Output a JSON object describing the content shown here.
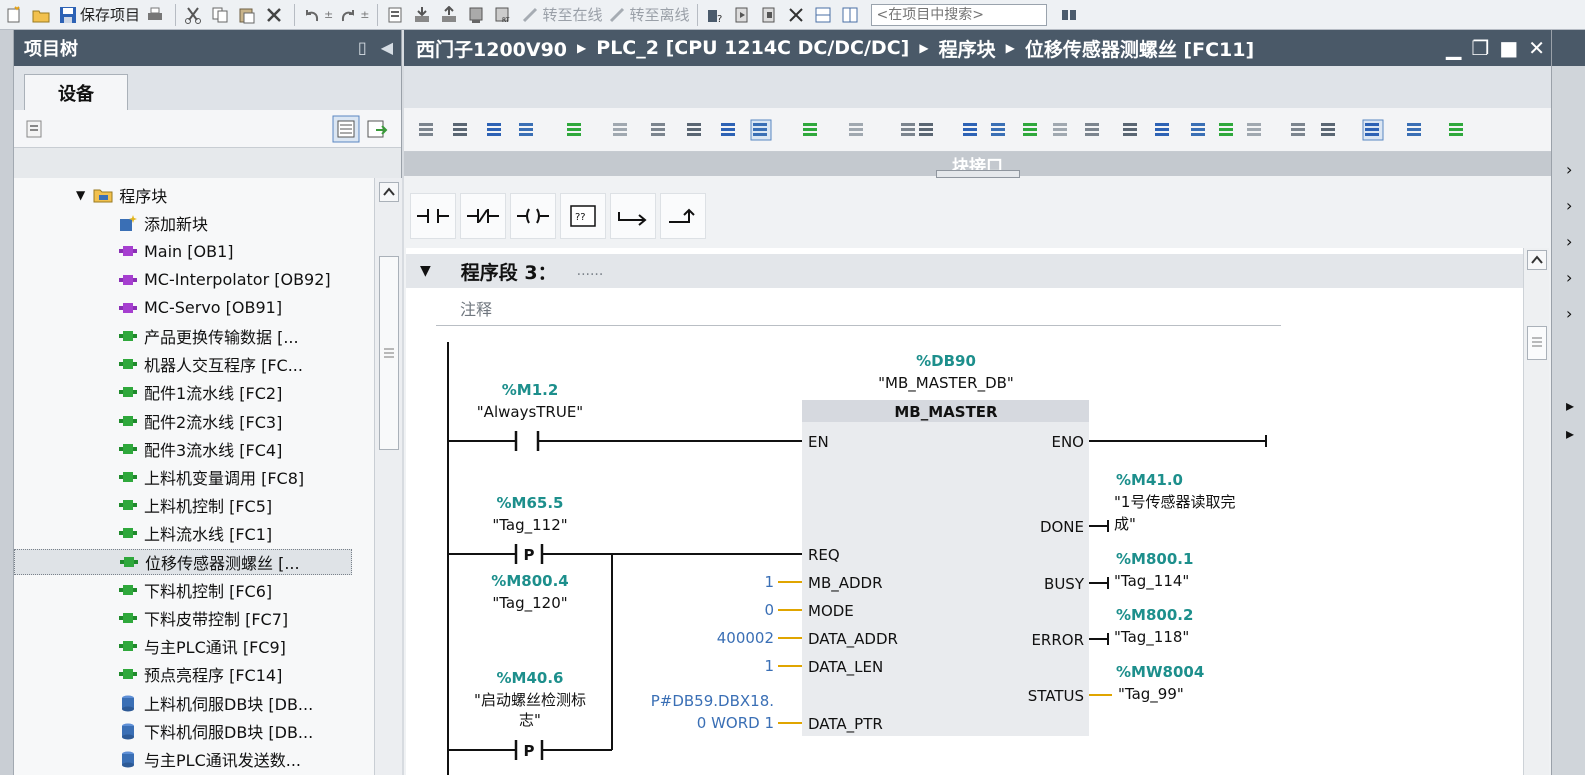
{
  "toolbar": {
    "save_project": "保存项目",
    "go_online": "转至在线",
    "go_offline": "转至离线",
    "search_placeholder": "<在项目中搜索>"
  },
  "project_tree": {
    "title": "项目树",
    "tab_devices": "设备",
    "items": [
      {
        "label": "程序块",
        "icon": "folder-icon",
        "level": 1,
        "expanded": true
      },
      {
        "label": "添加新块",
        "icon": "add-block-icon",
        "level": 2
      },
      {
        "label": "Main [OB1]",
        "icon": "ob-block-icon",
        "level": 2
      },
      {
        "label": "MC-Interpolator [OB92]",
        "icon": "ob-block-icon",
        "level": 2
      },
      {
        "label": "MC-Servo [OB91]",
        "icon": "ob-block-icon",
        "level": 2
      },
      {
        "label": "产品更换传输数据 [...",
        "icon": "fc-block-icon",
        "level": 2
      },
      {
        "label": "机器人交互程序 [FC...",
        "icon": "fc-block-icon",
        "level": 2
      },
      {
        "label": "配件1流水线 [FC2]",
        "icon": "fc-block-icon",
        "level": 2
      },
      {
        "label": "配件2流水线 [FC3]",
        "icon": "fc-block-icon",
        "level": 2
      },
      {
        "label": "配件3流水线 [FC4]",
        "icon": "fc-block-icon",
        "level": 2
      },
      {
        "label": "上料机变量调用 [FC8]",
        "icon": "fc-block-icon",
        "level": 2
      },
      {
        "label": "上料机控制 [FC5]",
        "icon": "fc-block-icon",
        "level": 2
      },
      {
        "label": "上料流水线 [FC1]",
        "icon": "fc-block-icon",
        "level": 2
      },
      {
        "label": "位移传感器测螺丝 [...",
        "icon": "fc-block-icon",
        "level": 2,
        "selected": true
      },
      {
        "label": "下料机控制 [FC6]",
        "icon": "fc-block-icon",
        "level": 2
      },
      {
        "label": "下料皮带控制 [FC7]",
        "icon": "fc-block-icon",
        "level": 2
      },
      {
        "label": "与主PLC通讯 [FC9]",
        "icon": "fc-block-icon",
        "level": 2
      },
      {
        "label": "预点亮程序 [FC14]",
        "icon": "fc-block-icon",
        "level": 2
      },
      {
        "label": "上料机伺服DB块 [DB...",
        "icon": "db-block-icon",
        "level": 2
      },
      {
        "label": "下料机伺服DB块 [DB...",
        "icon": "db-block-icon",
        "level": 2
      },
      {
        "label": "与主PLC通讯发送数...",
        "icon": "db-block-icon",
        "level": 2
      }
    ]
  },
  "editor": {
    "breadcrumb": [
      "西门子1200V90",
      "PLC_2 [CPU 1214C DC/DC/DC]",
      "程序块",
      "位移传感器测螺丝 [FC11]"
    ],
    "block_interface_label": "块接口",
    "network_title": "程序段 3：",
    "network_dots": "......",
    "comment_placeholder": "注释"
  },
  "ladder": {
    "instance_db_address": "%DB90",
    "instance_db_name": "\"MB_MASTER_DB\"",
    "block_name": "MB_MASTER",
    "contacts": [
      {
        "address": "%M1.2",
        "name": "\"AlwaysTRUE\"",
        "type": "NO"
      },
      {
        "address": "%M65.5",
        "name": "\"Tag_112\"",
        "type": "P"
      },
      {
        "address": "%M800.4",
        "name": "\"Tag_120\"",
        "type": "memory"
      },
      {
        "address": "%M40.6",
        "name1": "\"启动螺丝检测标",
        "name2": "志\"",
        "type": "P"
      }
    ],
    "pins_in": {
      "en": "EN",
      "req": "REQ",
      "mb_addr": "MB_ADDR",
      "mode": "MODE",
      "data_addr": "DATA_ADDR",
      "data_len": "DATA_LEN",
      "data_ptr": "DATA_PTR"
    },
    "pins_out": {
      "eno": "ENO",
      "done": "DONE",
      "busy": "BUSY",
      "error": "ERROR",
      "status": "STATUS"
    },
    "in_values": {
      "mb_addr": "1",
      "mode": "0",
      "data_addr": "400002",
      "data_len": "1",
      "data_ptr_1": "P#DB59.DBX18.",
      "data_ptr_2": "0 WORD 1"
    },
    "outputs": {
      "done_address": "%M41.0",
      "done_name_1": "\"1号传感器读取完",
      "done_name_2": "成\"",
      "busy_address": "%M800.1",
      "busy_name": "\"Tag_114\"",
      "error_address": "%M800.2",
      "error_name": "\"Tag_118\"",
      "status_address": "%MW8004",
      "status_name": "\"Tag_99\""
    }
  },
  "colors": {
    "title_bar": "#4a5968",
    "operand_address": "#1d8f8c",
    "constant_value": "#3a6fb5",
    "block_header": "#d6d9df",
    "block_body": "#e9ebee"
  }
}
